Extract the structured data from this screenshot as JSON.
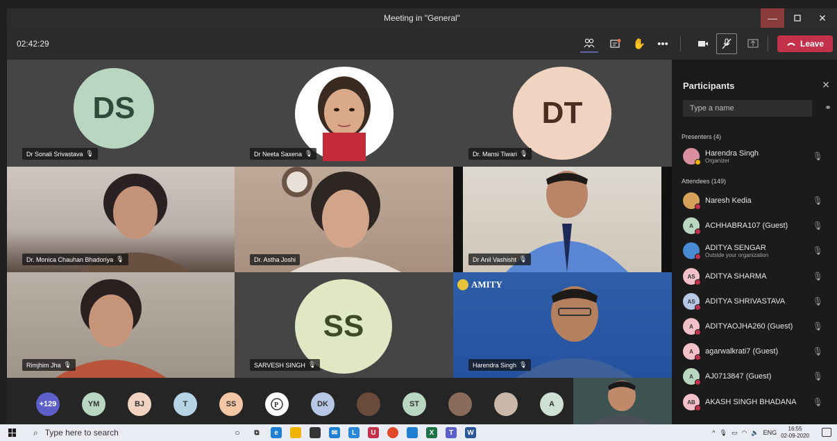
{
  "window": {
    "title": "Meeting in \"General\""
  },
  "toolbar": {
    "timer": "02:42:29",
    "leave_label": "Leave"
  },
  "tiles": [
    {
      "name": "Dr Sonali Srivastava",
      "initials": "DS",
      "type": "avatar"
    },
    {
      "name": "Dr Neeta Saxena",
      "initials": "",
      "type": "photo"
    },
    {
      "name": "Dr. Mansi Tiwari",
      "initials": "DT",
      "type": "avatar"
    },
    {
      "name": "Dr. Monica Chauhan Bhadoriya",
      "initials": "",
      "type": "video"
    },
    {
      "name": "Dr. Astha Joshi",
      "initials": "",
      "type": "video"
    },
    {
      "name": "Dr Anil Vashisht",
      "initials": "",
      "type": "video"
    },
    {
      "name": "Rimjhim Jha",
      "initials": "",
      "type": "video"
    },
    {
      "name": "SARVESH SINGH",
      "initials": "SS",
      "type": "avatar"
    },
    {
      "name": "Harendra Singh",
      "initials": "",
      "type": "video",
      "logo_text": "AMITY"
    }
  ],
  "overflow": {
    "more_count": "+129",
    "chips": [
      "YM",
      "BJ",
      "T",
      "SS",
      "",
      "DK",
      "",
      "ST",
      "",
      "",
      "A"
    ]
  },
  "panel": {
    "title": "Participants",
    "search_placeholder": "Type a name",
    "presenters_label": "Presenters (4)",
    "attendees_label": "Attendees (149)",
    "presenters": [
      {
        "name": "Harendra Singh",
        "sub": "Organizer",
        "initials": ""
      }
    ],
    "attendees": [
      {
        "name": "Naresh Kedia",
        "sub": "",
        "initials": ""
      },
      {
        "name": "ACHHABRA107 (Guest)",
        "sub": "",
        "initials": "A"
      },
      {
        "name": "ADITYA SENGAR",
        "sub": "Outside your organization",
        "initials": ""
      },
      {
        "name": "ADITYA SHARMA",
        "sub": "",
        "initials": "AS"
      },
      {
        "name": "ADITYA SHRIVASTAVA",
        "sub": "",
        "initials": "AS"
      },
      {
        "name": "ADITYAOJHA260 (Guest)",
        "sub": "",
        "initials": "A"
      },
      {
        "name": "agarwalkrati7 (Guest)",
        "sub": "",
        "initials": "A"
      },
      {
        "name": "AJ0713847 (Guest)",
        "sub": "",
        "initials": "A"
      },
      {
        "name": "AKASH SINGH BHADANA",
        "sub": "",
        "initials": "AB"
      }
    ]
  },
  "taskbar": {
    "search_placeholder": "Type here to search",
    "lang": "ENG",
    "time": "16:55",
    "date": "02-09-2020"
  },
  "colors": {
    "accent": "#6264a7",
    "leave": "#c4314b",
    "avatar_green": "#b9d7c0",
    "avatar_peach": "#f1d3c1",
    "avatar_blue": "#b7d3e6",
    "muted_dot": "#c4314b"
  }
}
